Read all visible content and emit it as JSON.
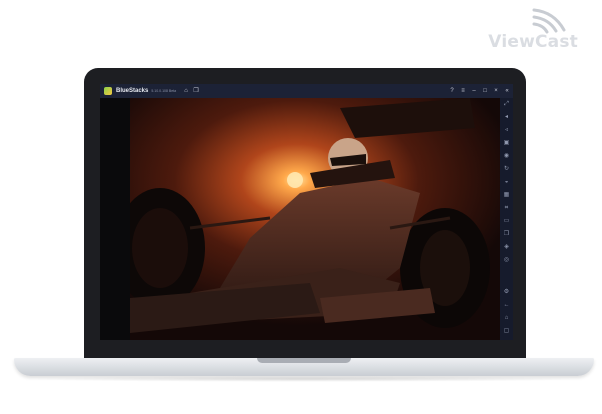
{
  "watermark": {
    "brand": "ViewCast"
  },
  "window": {
    "app_name": "BlueStacks",
    "version": "5.10.0.108 Beta",
    "title_icons": [
      "home-icon",
      "multi-instance-icon"
    ],
    "controls": [
      "help-icon",
      "menu-icon",
      "minimize-icon",
      "maximize-icon",
      "close-icon",
      "collapse-sidebar-icon"
    ]
  },
  "sidebar": {
    "items": [
      "fullscreen-icon",
      "volume-up-icon",
      "volume-down-icon",
      "media-icon",
      "screen-record-icon",
      "rotate-icon",
      "gamepad-icon",
      "keyboard-mapping-icon",
      "screenshot-icon",
      "folder-icon",
      "multi-instance-icon",
      "layers-icon",
      "eco-mode-icon",
      "settings-icon",
      "back-icon",
      "home-icon",
      "recents-icon"
    ]
  },
  "colors": {
    "titlebar": "#1c2236",
    "sidebar": "#161b2c",
    "accent": "#f5a623"
  }
}
